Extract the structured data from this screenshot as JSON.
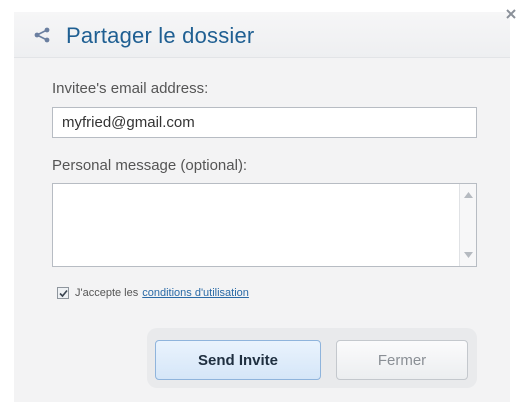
{
  "dialog": {
    "title": "Partager le dossier",
    "icons": {
      "title_icon": "share-icon",
      "close": "close-icon"
    }
  },
  "form": {
    "email_label": "Invitee's email address:",
    "email_value": "myfried@gmail.com",
    "message_label": "Personal message (optional):",
    "message_value": "",
    "terms_checked": true,
    "terms_text": "J'accepte les",
    "terms_link": "conditions d'utilisation"
  },
  "buttons": {
    "send_label": "Send Invite",
    "close_label": "Fermer"
  },
  "colors": {
    "title": "#1f5f92",
    "link": "#2a6aa6",
    "primary_button": "#d5e6f8"
  }
}
